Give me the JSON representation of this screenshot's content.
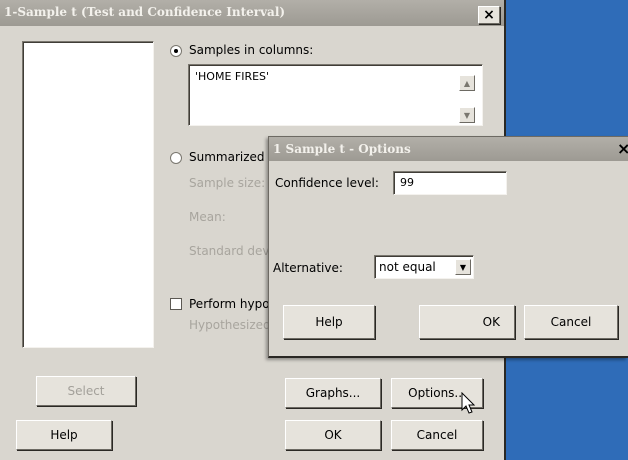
{
  "main_dialog": {
    "title": "1-Sample t (Test and Confidence Interval)",
    "close_label": "×",
    "samples_radio_label": "Samples in columns:",
    "samples_value": "'HOME FIRES'",
    "summarized_radio_label": "Summarized d",
    "sample_size_label": "Sample size:",
    "mean_label": "Mean:",
    "std_dev_label": "Standard devi",
    "perform_test_label": "Perform hypo",
    "hypothesized_label": "Hypothesized",
    "select_button": "Select",
    "help_button": "Help",
    "graphs_button": "Graphs...",
    "options_button": "Options...",
    "ok_button": "OK",
    "cancel_button": "Cancel"
  },
  "options_dialog": {
    "title": "1 Sample t - Options",
    "close_label": "×",
    "confidence_label": "Confidence level:",
    "confidence_value": "99",
    "alternative_label": "Alternative:",
    "alternative_value": "not equal",
    "help_button": "Help",
    "ok_button": "OK",
    "cancel_button": "Cancel"
  },
  "colors": {
    "desktop": "#2f6cb8",
    "dialog_face": "#d9d6cf",
    "titlebar": "#a7a49d"
  }
}
